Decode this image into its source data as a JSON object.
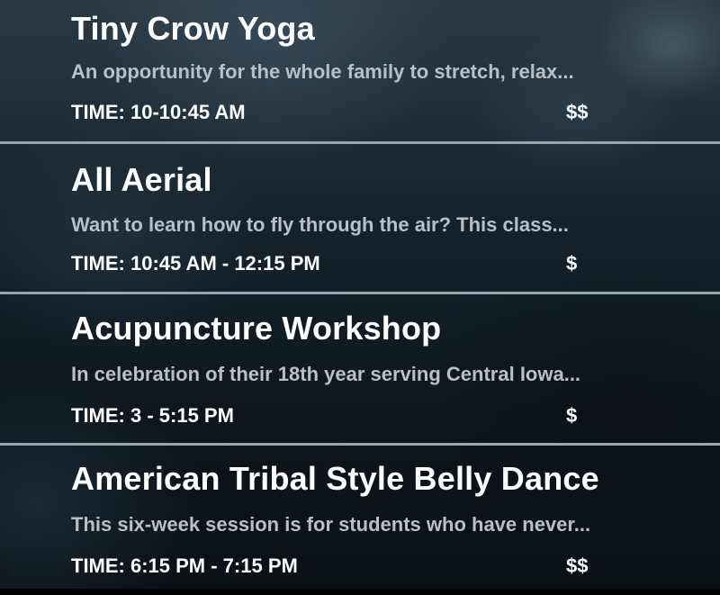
{
  "events": [
    {
      "title": "Tiny Crow Yoga",
      "description": "An opportunity for the whole family to stretch, relax...",
      "time": "TIME: 10-10:45 AM",
      "price": "$$"
    },
    {
      "title": "All Aerial",
      "description": "Want to learn how to fly through the air? This class...",
      "time": "TIME: 10:45 AM - 12:15 PM",
      "price": "$"
    },
    {
      "title": "Acupuncture Workshop",
      "description": "In celebration of their 18th year serving Central Iowa...",
      "time": "TIME: 3 - 5:15 PM",
      "price": "$"
    },
    {
      "title": "American Tribal Style Belly Dance",
      "description": "This six-week session is for students who have never...",
      "time": "TIME: 6:15 PM - 7:15 PM",
      "price": "$$"
    }
  ],
  "colors": {
    "title": "#ffffff",
    "description": "#b8c0c6",
    "divider": "#9aa4ab"
  }
}
